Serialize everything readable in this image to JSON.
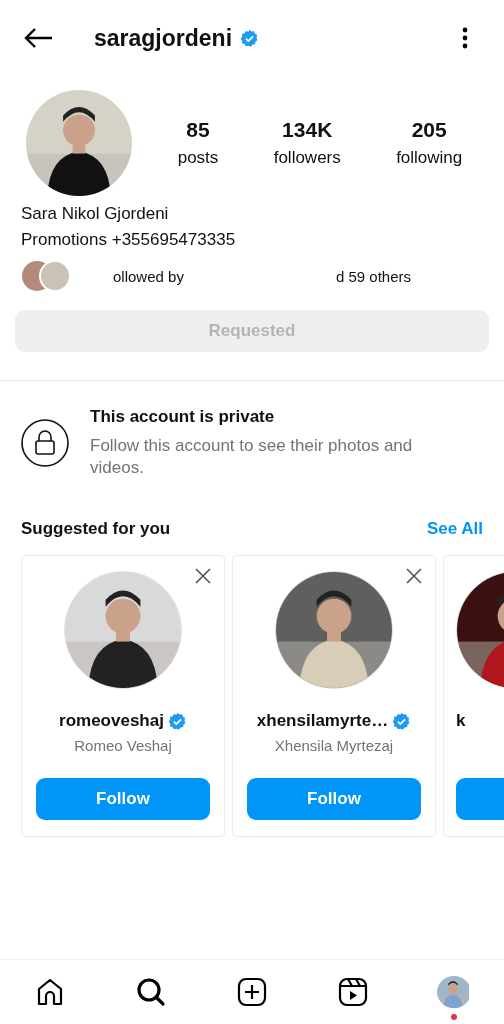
{
  "header": {
    "username": "saragjordeni",
    "verified": true
  },
  "profile": {
    "stats": [
      {
        "value": "85",
        "label": "posts"
      },
      {
        "value": "134K",
        "label": "followers"
      },
      {
        "value": "205",
        "label": "following"
      }
    ],
    "name": "Sara Nikol Gjordeni",
    "bio": "Promotions +355695473335",
    "followed_by": {
      "start": "ollowed by",
      "end": "d 59 others"
    },
    "action_button": "Requested"
  },
  "private_notice": {
    "title": "This account is private",
    "text": "Follow this account to see their photos and videos."
  },
  "suggestions": {
    "title": "Suggested for you",
    "see_all": "See All",
    "cards": [
      {
        "kind": "full",
        "username": "romeoveshaj",
        "verified": true,
        "name": "Romeo Veshaj",
        "button": "Follow"
      },
      {
        "kind": "full",
        "username": "xhensilamyrte…",
        "verified": true,
        "name": "Xhensila Myrtezaj",
        "button": "Follow"
      },
      {
        "kind": "partial",
        "username": "k"
      }
    ]
  },
  "bottom_nav": {
    "items": [
      {
        "kind": "home",
        "selected": false
      },
      {
        "kind": "search",
        "selected": true
      },
      {
        "kind": "create",
        "selected": false
      },
      {
        "kind": "reels",
        "selected": false
      },
      {
        "kind": "profile",
        "selected": false,
        "badge": true
      }
    ]
  }
}
